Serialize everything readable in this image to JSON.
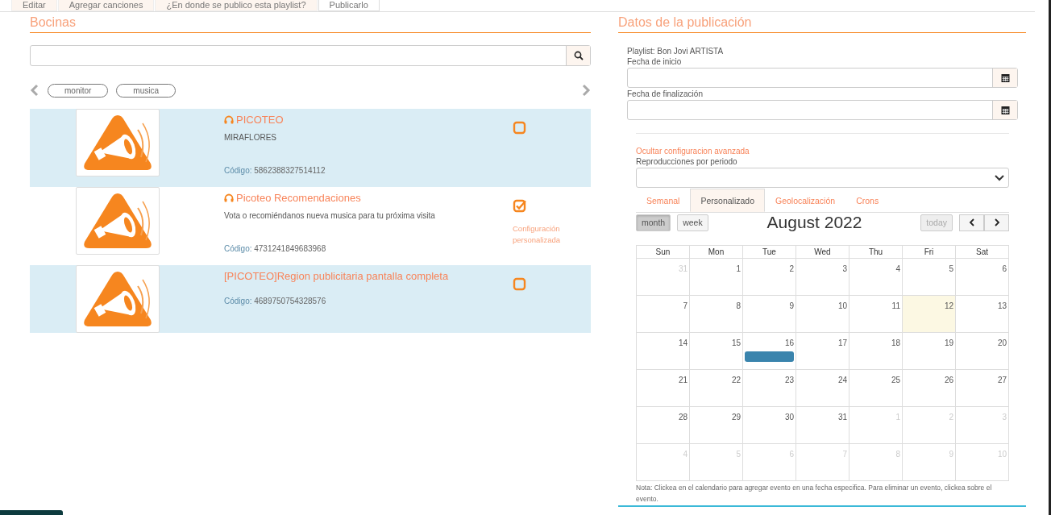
{
  "tabs": [
    {
      "label": "Editar",
      "selected": false
    },
    {
      "label": "Agregar canciones",
      "selected": false
    },
    {
      "label": "¿En donde se publico esta playlist?",
      "selected": false
    },
    {
      "label": "Publicarlo",
      "selected": true
    }
  ],
  "speakers_panel": {
    "title": "Bocinas",
    "tags": [
      "monitor",
      "musica"
    ],
    "speakers": [
      {
        "name": "PICOTEO",
        "headphones": true,
        "description": "MIRAFLORES",
        "code_label": "Código:",
        "code": "5862388327514112",
        "checked": false
      },
      {
        "name": "Picoteo Recomendaciones",
        "headphones": true,
        "description": "Vota o recomiéndanos nueva musica para tu próxima visita",
        "code_label": "Código:",
        "code": "4731241849683968",
        "checked": true,
        "note": "Configuración personalizada"
      },
      {
        "name": "[PICOTEO]Region publicitaria pantalla completa",
        "headphones": false,
        "code_label": "Código:",
        "code": "4689750754328576",
        "checked": false
      }
    ]
  },
  "publication_panel": {
    "title": "Datos de la publicación",
    "playlist": "Playlist: Bon Jovi ARTISTA",
    "date_fields": [
      {
        "label": "Fecha de inicio"
      },
      {
        "label": "Fecha de finalización"
      }
    ],
    "advanced_link": "Ocultar configuracion avanzada",
    "select_label": "Reproducciones por periodo",
    "subtabs": [
      {
        "label": "Semanal",
        "selected": false
      },
      {
        "label": "Personalizado",
        "selected": true
      },
      {
        "label": "Geolocalización",
        "selected": false
      },
      {
        "label": "Crons",
        "selected": false
      }
    ],
    "calendar": {
      "views": [
        {
          "label": "month",
          "selected": true
        },
        {
          "label": "week",
          "selected": false
        }
      ],
      "title": "August 2022",
      "today_button": {
        "label": "today",
        "disabled": true
      },
      "weekdays": [
        "Sun",
        "Mon",
        "Tue",
        "Wed",
        "Thu",
        "Fri",
        "Sat"
      ],
      "weeks": [
        [
          {
            "day": "31",
            "other": true
          },
          {
            "day": "1"
          },
          {
            "day": "2"
          },
          {
            "day": "3"
          },
          {
            "day": "4"
          },
          {
            "day": "5"
          },
          {
            "day": "6"
          }
        ],
        [
          {
            "day": "7"
          },
          {
            "day": "8"
          },
          {
            "day": "9"
          },
          {
            "day": "10"
          },
          {
            "day": "11"
          },
          {
            "day": "12",
            "today": true
          },
          {
            "day": "13"
          }
        ],
        [
          {
            "day": "14"
          },
          {
            "day": "15"
          },
          {
            "day": "16",
            "event": true
          },
          {
            "day": "17"
          },
          {
            "day": "18"
          },
          {
            "day": "19"
          },
          {
            "day": "20"
          }
        ],
        [
          {
            "day": "21"
          },
          {
            "day": "22"
          },
          {
            "day": "23"
          },
          {
            "day": "24"
          },
          {
            "day": "25"
          },
          {
            "day": "26"
          },
          {
            "day": "27"
          }
        ],
        [
          {
            "day": "28"
          },
          {
            "day": "29"
          },
          {
            "day": "30"
          },
          {
            "day": "31"
          },
          {
            "day": "1",
            "other": true
          },
          {
            "day": "2",
            "other": true
          },
          {
            "day": "3",
            "other": true
          }
        ],
        [
          {
            "day": "4",
            "other": true
          },
          {
            "day": "5",
            "other": true
          },
          {
            "day": "6",
            "other": true
          },
          {
            "day": "7",
            "other": true
          },
          {
            "day": "8",
            "other": true
          },
          {
            "day": "9",
            "other": true
          },
          {
            "day": "10",
            "other": true
          }
        ]
      ]
    },
    "note": "Nota: Clickea en el calendario para agregar evento en una fecha especifica. Para eliminar un evento, clickea sobre el evento."
  }
}
